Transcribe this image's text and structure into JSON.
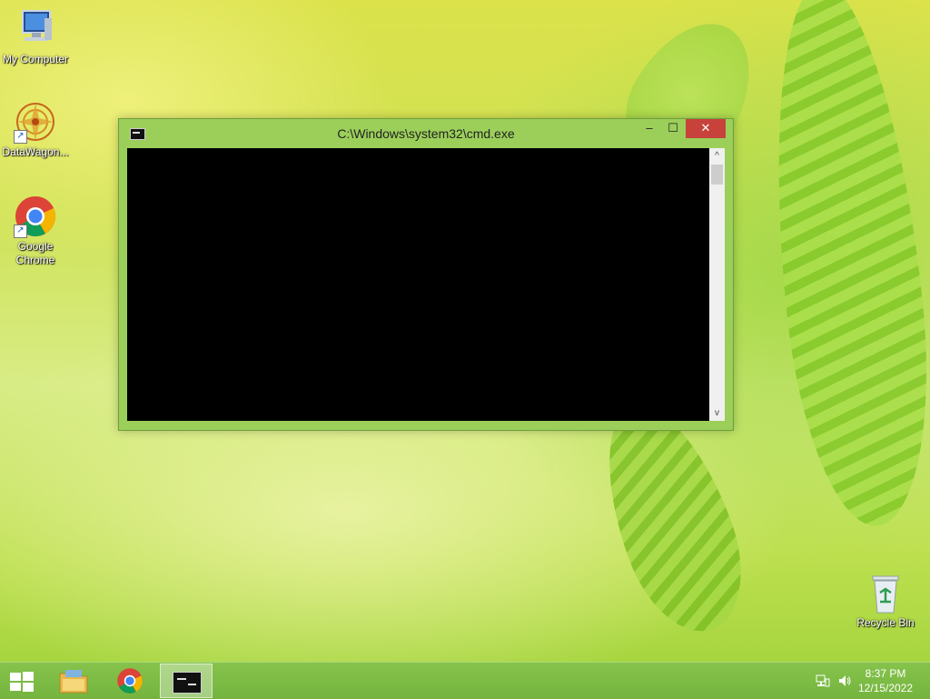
{
  "desktop": {
    "icons": [
      {
        "label": "My Computer",
        "icon": "computer-icon"
      },
      {
        "label": "DataWagon...",
        "icon": "datawagon-icon"
      },
      {
        "label": "Google Chrome",
        "icon": "chrome-icon"
      },
      {
        "label": "Recycle Bin",
        "icon": "recycle-bin-icon"
      }
    ]
  },
  "window": {
    "title": "C:\\Windows\\system32\\cmd.exe",
    "minimize_glyph": "–",
    "maximize_glyph": "☐",
    "close_glyph": "✕",
    "scroll_up_glyph": "^",
    "scroll_down_glyph": "v"
  },
  "taskbar": {
    "items": [
      "start-button",
      "file-explorer",
      "google-chrome",
      "command-prompt"
    ],
    "active_item": "command-prompt",
    "time": "8:37 PM",
    "date": "12/15/2022"
  },
  "colors": {
    "titlebar": "#9bcf5a",
    "close_button": "#c7423a",
    "console_bg": "#000000",
    "taskbar": "#7cbb44"
  }
}
